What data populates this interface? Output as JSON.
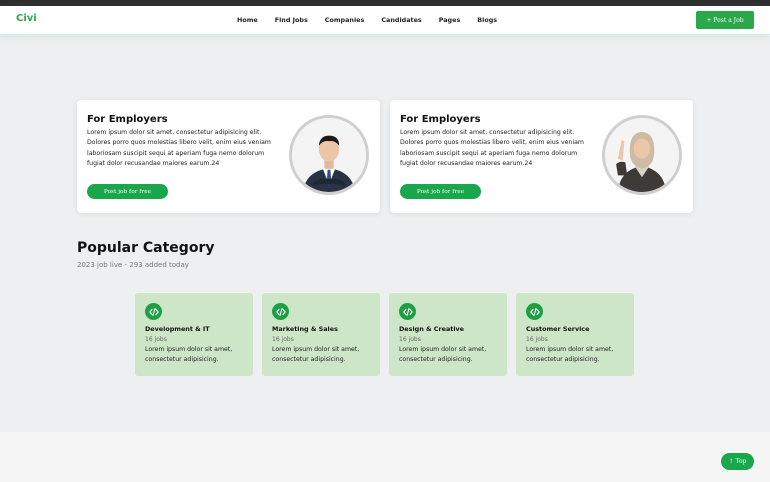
{
  "brand": {
    "logo": "Civi",
    "accent_color": "#2aa84a"
  },
  "nav": {
    "links": [
      "Home",
      "Find Jobs",
      "Companies",
      "Candidates",
      "Pages",
      "Blogs"
    ],
    "cta": "+ Post a Job"
  },
  "employers": [
    {
      "title": "For Employers",
      "description": "Lorem ipsum dolor sit amet, consectetur adipisicing elit. Dolores porro quos molestias libero velit, enim eius veniam laboriosam suscipit sequi at aperiam fuga nemo dolorum fugiat dolor recusandae maiores earum.24",
      "button": "Post job for free",
      "image": "businessman-portrait"
    },
    {
      "title": "For Employers",
      "description": "Lorem ipsum dolor sit amet, consectetur adipisicing elit. Dolores porro quos molestias libero velit, enim eius veniam laboriosam suscipit sequi at aperiam fuga nemo dolorum fugiat dolor recusandae maiores earum.24",
      "button": "Post job for free",
      "image": "businesswoman-portrait"
    }
  ],
  "popular": {
    "title": "Popular Category",
    "subtitle": "2023 job live - 293 added today",
    "categories": [
      {
        "name": "Development & IT",
        "count": "16 jobs",
        "description": "Lorem ipsum dolor sit amet, consectetur adipisicing.",
        "icon": "code-icon"
      },
      {
        "name": "Marketing & Sales",
        "count": "16 jobs",
        "description": "Lorem ipsum dolor sit amet, consectetur adipisicing.",
        "icon": "code-icon"
      },
      {
        "name": "Design & Creative",
        "count": "16 jobs",
        "description": "Lorem ipsum dolor sit amet, consectetur adipisicing.",
        "icon": "code-icon"
      },
      {
        "name": "Customer Service",
        "count": "16 jobs",
        "description": "Lorem ipsum dolor sit amet, consectetur adipisicing.",
        "icon": "code-icon"
      }
    ]
  },
  "scroll_top": "↑ Top"
}
